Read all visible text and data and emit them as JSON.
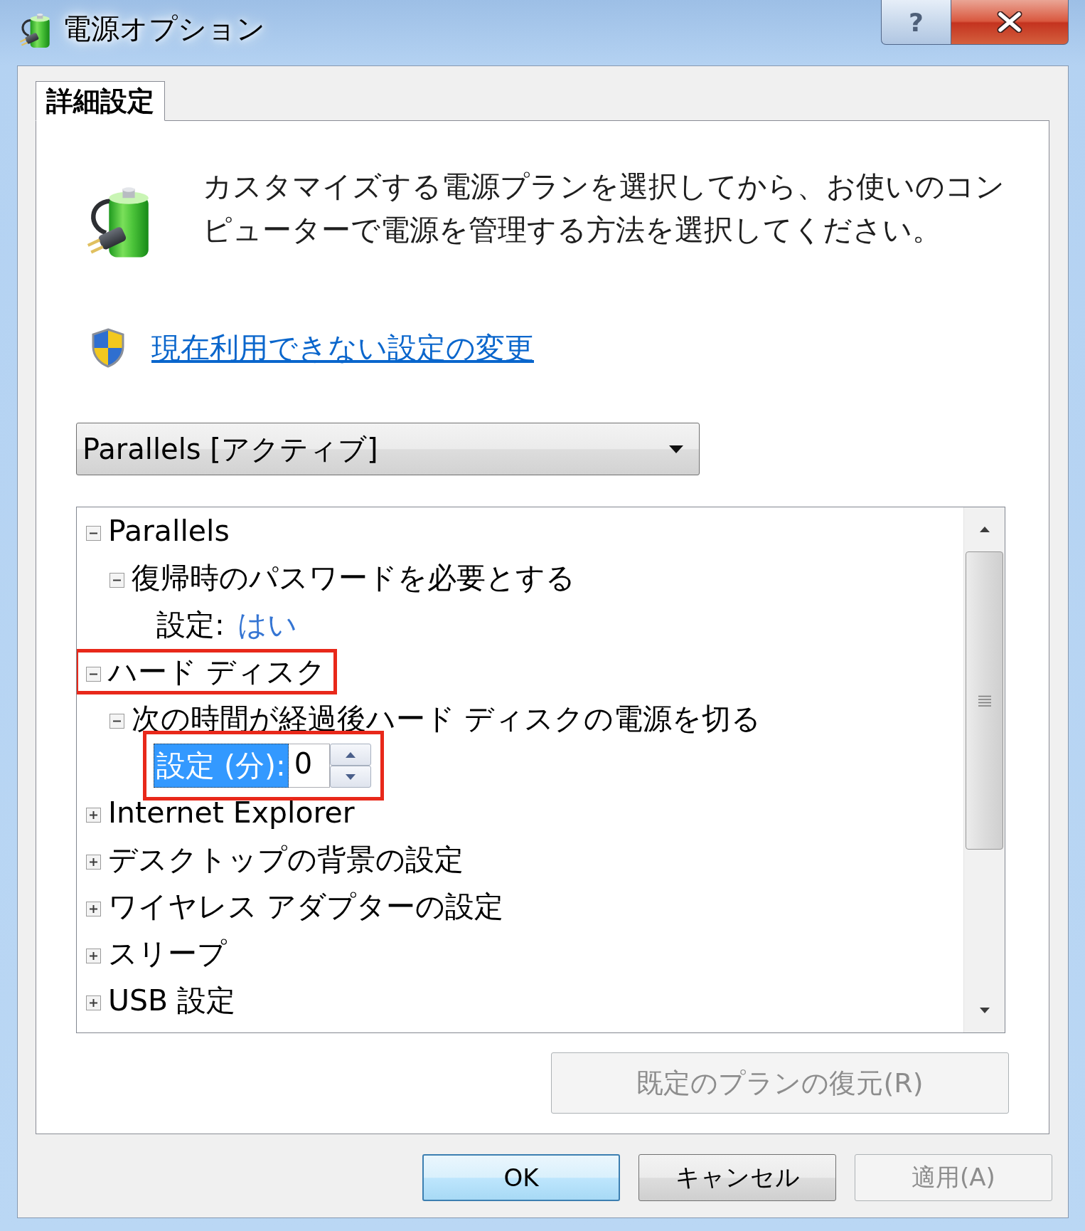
{
  "window": {
    "title": "電源オプション"
  },
  "caption_buttons": [
    {
      "kind": "help",
      "label": "?"
    },
    {
      "kind": "close"
    }
  ],
  "tabs": [
    {
      "label": "詳細設定",
      "selected": true
    }
  ],
  "description": "カスタマイズする電源プランを選択してから、お使いのコンピューターで電源を管理する方法を選択してください。",
  "admin_link": "現在利用できない設定の変更",
  "plan_dropdown": {
    "value": "Parallels [アクティブ]"
  },
  "tree": [
    {
      "label": "Parallels",
      "expanded": true,
      "callout": false,
      "children": [
        {
          "label": "復帰時のパスワードを必要とする",
          "expanded": true,
          "callout": false,
          "setting": {
            "kind": "text",
            "label": "設定:",
            "value": "はい",
            "selected": false,
            "callout": false
          }
        }
      ]
    },
    {
      "label": "ハード ディスク",
      "expanded": true,
      "callout": true,
      "children": [
        {
          "label": "次の時間が経過後ハード ディスクの電源を切る",
          "expanded": true,
          "callout": false,
          "setting": {
            "kind": "spinner",
            "label": "設定 (分):",
            "value": "0",
            "selected": true,
            "callout": true
          }
        }
      ]
    },
    {
      "label": "Internet Explorer",
      "expanded": false,
      "callout": false
    },
    {
      "label": "デスクトップの背景の設定",
      "expanded": false,
      "callout": false
    },
    {
      "label": "ワイヤレス アダプターの設定",
      "expanded": false,
      "callout": false
    },
    {
      "label": "スリープ",
      "expanded": false,
      "callout": false
    },
    {
      "label": "USB 設定",
      "expanded": false,
      "callout": false
    }
  ],
  "restore_button": {
    "label": "既定のプランの復元(R)",
    "disabled": true
  },
  "buttons": [
    {
      "label": "OK",
      "default": true,
      "disabled": false
    },
    {
      "label": "キャンセル",
      "default": false,
      "disabled": false
    },
    {
      "label": "適用(A)",
      "default": false,
      "disabled": true
    }
  ]
}
